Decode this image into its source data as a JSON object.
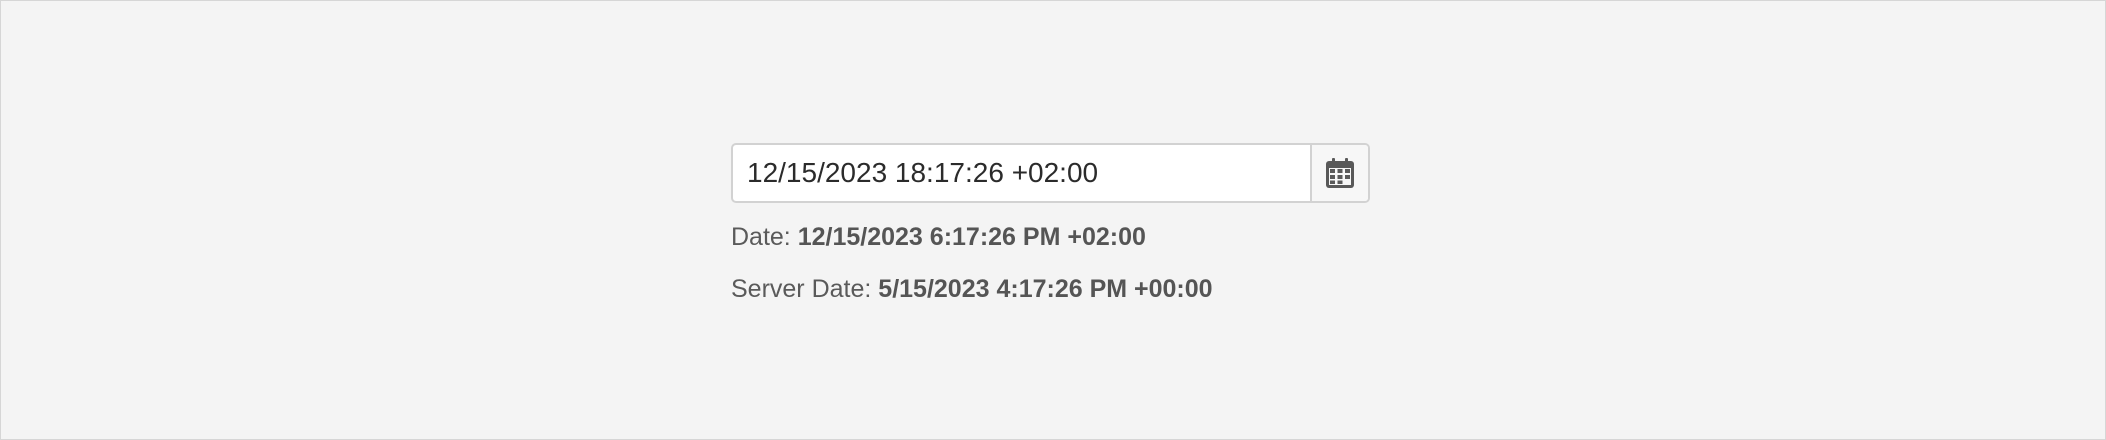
{
  "datetimepicker": {
    "value": "12/15/2023 18:17:26 +02:00",
    "button_icon": "calendar-icon"
  },
  "info": {
    "date_label": "Date:",
    "date_value": "12/15/2023 6:17:26 PM +02:00",
    "server_date_label": "Server Date:",
    "server_date_value": "5/15/2023 4:17:26 PM +00:00"
  },
  "colors": {
    "background": "#f4f4f4",
    "border": "#d2d2d2",
    "icon": "#595959"
  }
}
